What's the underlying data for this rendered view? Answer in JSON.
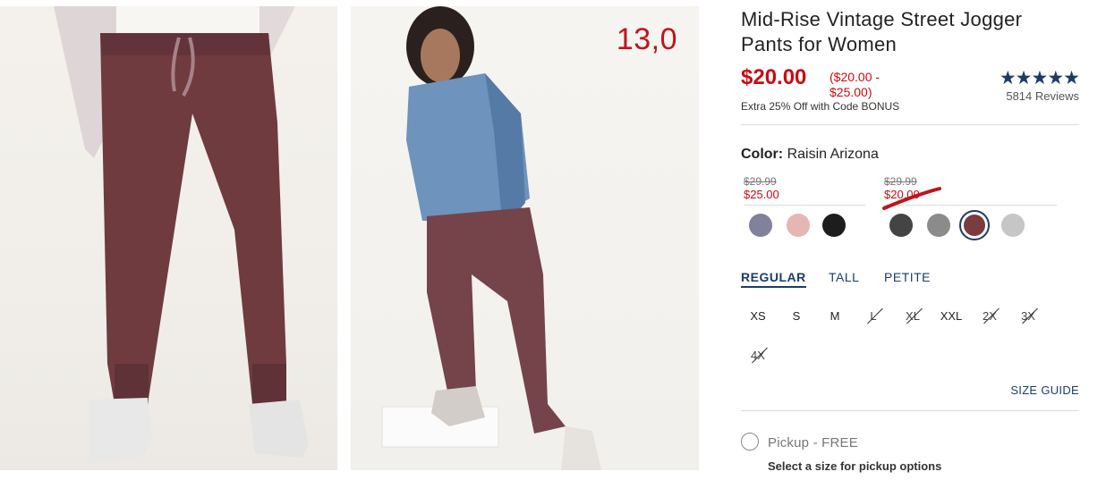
{
  "product": {
    "title": "Mid-Rise Vintage Street Jogger Pants for Women",
    "price_now": "$20.00",
    "price_range": "($20.00 - $25.00)",
    "promo": "Extra 25% Off with Code BONUS",
    "rating_stars": "★★★★★",
    "rating_value": 5,
    "reviews": "5814 Reviews"
  },
  "overlay_number": "13,0",
  "color": {
    "label": "Color:",
    "value": "Raisin Arizona",
    "groups": [
      {
        "was": "$29.99",
        "now": "$25.00"
      },
      {
        "was": "$29.99",
        "now": "$20.00"
      }
    ],
    "swatches": [
      {
        "name": "blue-grey",
        "hex": "#7f829a"
      },
      {
        "name": "blush",
        "hex": "#e4b7b2"
      },
      {
        "name": "black",
        "hex": "#1d1d1d"
      },
      {
        "name": "charcoal",
        "hex": "#444444"
      },
      {
        "name": "heather-grey",
        "hex": "#8b8b8b"
      },
      {
        "name": "raisin-arizona",
        "hex": "#7a3c3f",
        "selected": true
      },
      {
        "name": "light-heather",
        "hex": "#c6c6c6"
      }
    ],
    "accent": "#cc0a12",
    "brand": "#1b3c6b"
  },
  "fit_tabs": [
    {
      "label": "REGULAR",
      "active": true
    },
    {
      "label": "TALL"
    },
    {
      "label": "PETITE"
    }
  ],
  "sizes": [
    {
      "label": "XS",
      "available": true
    },
    {
      "label": "S",
      "available": true
    },
    {
      "label": "M",
      "available": true
    },
    {
      "label": "L",
      "available": false
    },
    {
      "label": "XL",
      "available": false
    },
    {
      "label": "XXL",
      "available": true
    },
    {
      "label": "2X",
      "available": false
    },
    {
      "label": "3X",
      "available": false
    },
    {
      "label": "4X",
      "available": false
    }
  ],
  "size_guide": "SIZE GUIDE",
  "pickup": {
    "label": "Pickup - FREE",
    "note": "Select a size for pickup options"
  }
}
